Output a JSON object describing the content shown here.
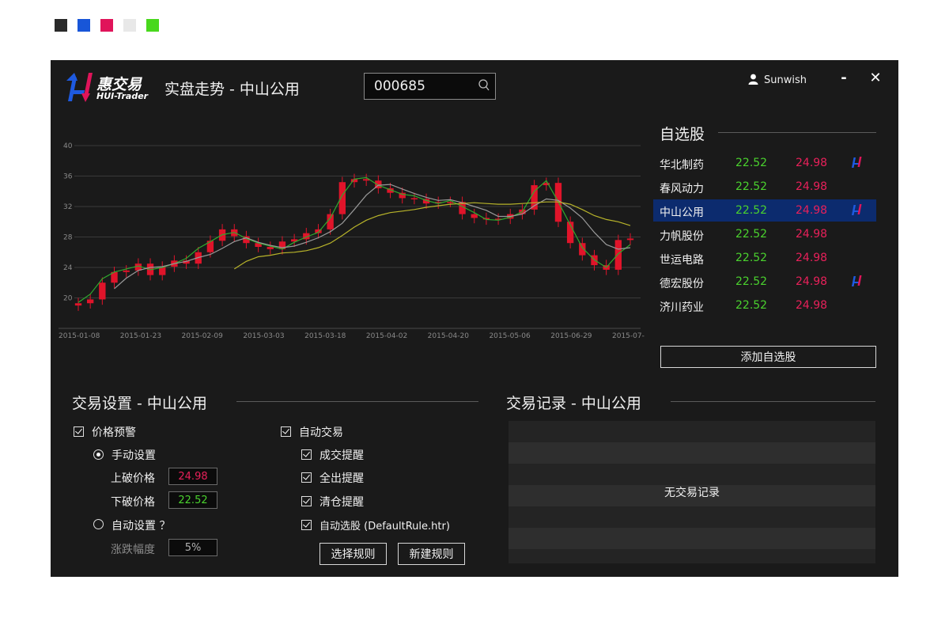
{
  "swatches": [
    {
      "name": "dark",
      "color": "#2a2a2a"
    },
    {
      "name": "blue",
      "color": "#1856d8"
    },
    {
      "name": "pink",
      "color": "#e0145a"
    },
    {
      "name": "light-gray",
      "color": "#e8e8e8"
    },
    {
      "name": "green",
      "color": "#48d81c"
    }
  ],
  "header": {
    "logo_cn": "惠交易",
    "logo_en": "HUI-Trader",
    "title": "实盘走势 - 中山公用",
    "search_value": "000685",
    "username": "Sunwish",
    "minimize_label": "-",
    "close_label": "✕"
  },
  "chart_data": {
    "type": "candlestick",
    "title": "",
    "y_ticks": [
      "40",
      "36",
      "32",
      "28",
      "24",
      "20"
    ],
    "ylim": [
      16,
      40
    ],
    "x_ticks": [
      "2015-01-08",
      "2015-01-23",
      "2015-02-09",
      "2015-03-03",
      "2015-03-18",
      "2015-04-02",
      "2015-04-20",
      "2015-05-06",
      "2015-06-29",
      "2015-07-"
    ],
    "candle_color": "#e0142a",
    "ma_series": [
      {
        "color": "#2eaa2e",
        "values": [
          19.4,
          20.5,
          22.5,
          23.4,
          23.8,
          24.2,
          23.7,
          24.0,
          24.5,
          25.2,
          26.5,
          27.4,
          28.3,
          28.6,
          27.8,
          27.2,
          26.8,
          26.4,
          27.3,
          28.0,
          28.6,
          30.5,
          33.5,
          35.6,
          35.8,
          34.8,
          34.2,
          33.6,
          33.4,
          32.8,
          32.4,
          32.8,
          32.0,
          31.2,
          30.3,
          30.2,
          30.6,
          31.3,
          34.0,
          35.4,
          32.6,
          29.6,
          26.6,
          25.0,
          24.0,
          25.8,
          27.0
        ]
      },
      {
        "color": "#9a9a9a",
        "values": [
          null,
          null,
          null,
          21.2,
          22.6,
          23.6,
          24.0,
          24.1,
          24.5,
          24.8,
          25.3,
          25.7,
          26.5,
          27.4,
          27.9,
          27.3,
          26.9,
          26.6,
          26.8,
          27.3,
          27.9,
          28.7,
          29.8,
          31.6,
          33.5,
          34.8,
          34.9,
          34.3,
          33.7,
          33.2,
          32.8,
          32.9,
          32.5,
          32.0,
          31.5,
          30.7,
          30.7,
          31.0,
          32.1,
          33.0,
          32.8,
          31.8,
          30.5,
          28.6,
          27.0,
          26.4,
          26.6
        ]
      },
      {
        "color": "#b8b42a",
        "values": [
          null,
          null,
          null,
          null,
          null,
          null,
          null,
          null,
          null,
          null,
          null,
          null,
          null,
          23.8,
          24.8,
          25.4,
          25.6,
          25.9,
          26.0,
          26.2,
          26.6,
          27.2,
          28.2,
          29.3,
          30.2,
          30.8,
          31.2,
          31.4,
          31.6,
          31.9,
          32.1,
          32.3,
          32.4,
          32.5,
          32.4,
          32.3,
          32.3,
          32.4,
          32.5,
          32.6,
          32.6,
          32.3,
          31.6,
          30.8,
          30.3,
          30.0,
          29.5
        ]
      }
    ],
    "close": [
      19.3,
      19.8,
      22.0,
      23.4,
      23.6,
      24.5,
      23.0,
      24.1,
      24.9,
      24.5,
      26.0,
      27.5,
      29.0,
      28.1,
      27.2,
      26.7,
      26.4,
      27.4,
      27.7,
      28.5,
      29.0,
      31.0,
      35.2,
      35.6,
      35.4,
      34.4,
      33.8,
      33.1,
      33.0,
      32.4,
      32.6,
      32.6,
      31.0,
      30.5,
      30.3,
      30.4,
      31.0,
      31.6,
      34.8,
      35.1,
      30.0,
      27.2,
      25.6,
      24.3,
      23.7,
      27.6,
      27.8
    ]
  },
  "watchlist": {
    "title": "自选股",
    "items": [
      {
        "name": "华北制药",
        "low": "22.52",
        "high": "24.98",
        "flag": true,
        "selected": false
      },
      {
        "name": "春风动力",
        "low": "22.52",
        "high": "24.98",
        "flag": false,
        "selected": false
      },
      {
        "name": "中山公用",
        "low": "22.52",
        "high": "24.98",
        "flag": true,
        "selected": true
      },
      {
        "name": "力帆股份",
        "low": "22.52",
        "high": "24.98",
        "flag": false,
        "selected": false
      },
      {
        "name": "世运电路",
        "low": "22.52",
        "high": "24.98",
        "flag": false,
        "selected": false
      },
      {
        "name": "德宏股份",
        "low": "22.52",
        "high": "24.98",
        "flag": true,
        "selected": false
      },
      {
        "name": "济川药业",
        "low": "22.52",
        "high": "24.98",
        "flag": false,
        "selected": false
      }
    ],
    "add_button": "添加自选股"
  },
  "settings": {
    "title": "交易设置 - 中山公用",
    "price_alert": "价格预警",
    "manual": "手动设置",
    "upper_label": "上破价格",
    "upper_value": "24.98",
    "lower_label": "下破价格",
    "lower_value": "22.52",
    "auto": "自动设置 ？",
    "range_label": "涨跌幅度",
    "range_value": "5%",
    "auto_trade": "自动交易",
    "deal_alert": "成交提醒",
    "sellall_alert": "全出提醒",
    "clear_alert": "清仓提醒",
    "auto_pick": "自动选股 (DefaultRule.htr)",
    "choose_rule": "选择规则",
    "new_rule": "新建规则"
  },
  "records": {
    "title": "交易记录 - 中山公用",
    "empty": "无交易记录"
  }
}
